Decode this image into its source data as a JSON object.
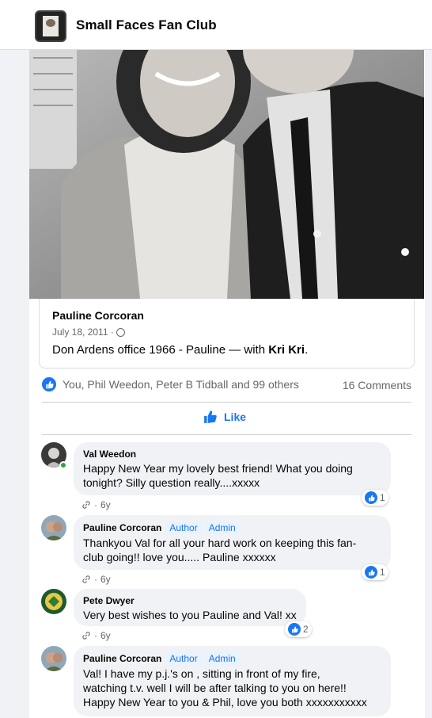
{
  "group": {
    "name": "Small Faces Fan Club"
  },
  "post": {
    "author": "Pauline Corcoran",
    "date": "July 18, 2011 ·",
    "text_prefix": "Don Ardens office 1966 - Pauline — with ",
    "tagged": "Kri Kri",
    "text_suffix": "."
  },
  "reactions": {
    "summary": "You, Phil Weedon, Peter B Tidball and 99 others",
    "comments": "16 Comments"
  },
  "actions": {
    "like": "Like"
  },
  "comments": [
    {
      "name": "Val Weedon",
      "author_tag": "",
      "admin_tag": "",
      "lines": [
        "Happy New Year my lovely best friend! What you doing",
        "tonight? Silly question really....xxxxx"
      ],
      "time": "6y",
      "likes": "1"
    },
    {
      "name": "Pauline Corcoran",
      "author_tag": "Author",
      "admin_tag": "Admin",
      "lines": [
        "Thankyou Val for all your hard work on keeping this fan-",
        "club going!! love you..... Pauline xxxxxx"
      ],
      "time": "6y",
      "likes": "1"
    },
    {
      "name": "Pete Dwyer",
      "author_tag": "",
      "admin_tag": "",
      "lines": [
        "Very best wishes to you Pauline and Val! xx"
      ],
      "time": "6y",
      "likes": "2"
    },
    {
      "name": "Pauline Corcoran",
      "author_tag": "Author",
      "admin_tag": "Admin",
      "lines": [
        "Val! I have my p.j.'s on , sitting in front of my fire,",
        "watching t.v. well I will be after talking to you on here!!",
        "Happy New Year to you & Phil, love you both xxxxxxxxxxx"
      ],
      "time": "",
      "likes": ""
    }
  ],
  "colors": {
    "accent": "#1877f2",
    "tag_bg": "#e7f3ff",
    "online": "#31a24c"
  }
}
